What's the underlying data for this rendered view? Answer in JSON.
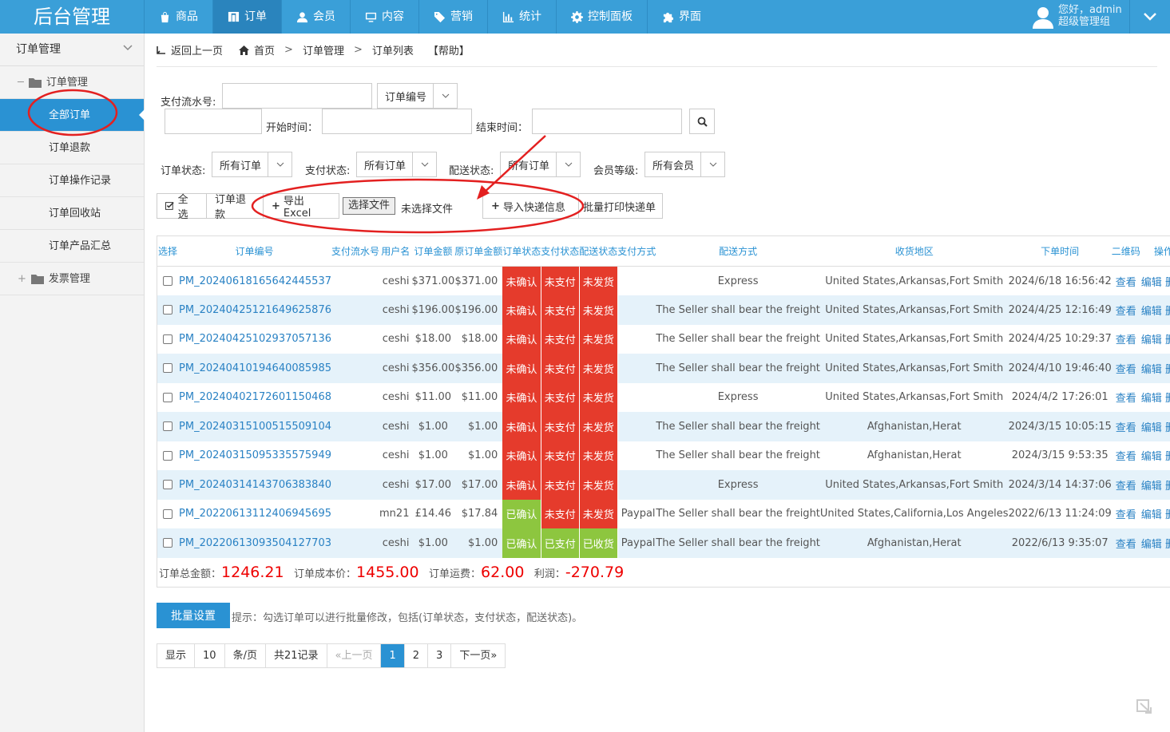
{
  "app": {
    "title": "后台管理"
  },
  "topnav": [
    {
      "label": "商品",
      "icon": "bag-icon"
    },
    {
      "label": "订单",
      "icon": "grid-icon",
      "active": true
    },
    {
      "label": "会员",
      "icon": "user-icon"
    },
    {
      "label": "内容",
      "icon": "monitor-icon"
    },
    {
      "label": "营销",
      "icon": "tag-icon"
    },
    {
      "label": "统计",
      "icon": "bar-chart-icon"
    },
    {
      "label": "控制面板",
      "icon": "gear-icon"
    },
    {
      "label": "界面",
      "icon": "puzzle-icon"
    }
  ],
  "user": {
    "greeting": "您好，admin",
    "role": "超级管理组"
  },
  "sidebar": {
    "header": "订单管理",
    "folder1": "订单管理",
    "items": [
      "全部订单",
      "订单退款",
      "订单操作记录",
      "订单回收站",
      "订单产品汇总"
    ],
    "folder2": "发票管理"
  },
  "breadcrumb": {
    "back": "返回上一页",
    "home": "首页",
    "c1": "订单管理",
    "c2": "订单列表",
    "help": "【帮助】"
  },
  "filters": {
    "pay_serial_label": "支付流水号:",
    "order_no_select": "订单编号",
    "start_label": "开始时间：",
    "end_label": "结束时间：",
    "order_status_label": "订单状态:",
    "order_status_value": "所有订单",
    "pay_status_label": "支付状态:",
    "pay_status_value": "所有订单",
    "ship_status_label": "配送状态:",
    "ship_status_value": "所有订单",
    "member_level_label": "会员等级:",
    "member_level_value": "所有会员"
  },
  "toolbar": {
    "select_all": "全选",
    "refund": "订单退款",
    "export": "导出Excel",
    "choose_file": "选择文件",
    "no_file": "未选择文件",
    "import": "导入快递信息",
    "print": "批量打印快递单"
  },
  "table": {
    "headers": [
      "选择",
      "订单编号",
      "支付流水号",
      "用户名",
      "订单金额",
      "原订单金额",
      "订单状态",
      "支付状态",
      "配送状态",
      "支付方式",
      "配送方式",
      "收货地区",
      "下单时间",
      "二维码",
      "操作"
    ],
    "rows": [
      {
        "id": "PM_20240618165642445537",
        "user": "ceshi",
        "amount": "$371.00",
        "orig": "$371.00",
        "os": "未确认",
        "ps": "未支付",
        "ss": "未发货",
        "pay": "",
        "ship": "Express",
        "region": "United States,Arkansas,Fort Smith",
        "time": "2024/6/18 16:56:42"
      },
      {
        "id": "PM_20240425121649625876",
        "user": "ceshi",
        "amount": "$196.00",
        "orig": "$196.00",
        "os": "未确认",
        "ps": "未支付",
        "ss": "未发货",
        "pay": "",
        "ship": "The Seller shall bear the freight",
        "region": "United States,Arkansas,Fort Smith",
        "time": "2024/4/25 12:16:49"
      },
      {
        "id": "PM_20240425102937057136",
        "user": "ceshi",
        "amount": "$18.00",
        "orig": "$18.00",
        "os": "未确认",
        "ps": "未支付",
        "ss": "未发货",
        "pay": "",
        "ship": "The Seller shall bear the freight",
        "region": "United States,Arkansas,Fort Smith",
        "time": "2024/4/25 10:29:37"
      },
      {
        "id": "PM_20240410194640085985",
        "user": "ceshi",
        "amount": "$356.00",
        "orig": "$356.00",
        "os": "未确认",
        "ps": "未支付",
        "ss": "未发货",
        "pay": "",
        "ship": "The Seller shall bear the freight",
        "region": "United States,Arkansas,Fort Smith",
        "time": "2024/4/10 19:46:40"
      },
      {
        "id": "PM_20240402172601150468",
        "user": "ceshi",
        "amount": "$11.00",
        "orig": "$11.00",
        "os": "未确认",
        "ps": "未支付",
        "ss": "未发货",
        "pay": "",
        "ship": "Express",
        "region": "United States,Arkansas,Fort Smith",
        "time": "2024/4/2 17:26:01"
      },
      {
        "id": "PM_20240315100515509104",
        "user": "ceshi",
        "amount": "$1.00",
        "orig": "$1.00",
        "os": "未确认",
        "ps": "未支付",
        "ss": "未发货",
        "pay": "",
        "ship": "The Seller shall bear the freight",
        "region": "Afghanistan,Herat",
        "time": "2024/3/15 10:05:15"
      },
      {
        "id": "PM_20240315095335575949",
        "user": "ceshi",
        "amount": "$1.00",
        "orig": "$1.00",
        "os": "未确认",
        "ps": "未支付",
        "ss": "未发货",
        "pay": "",
        "ship": "The Seller shall bear the freight",
        "region": "Afghanistan,Herat",
        "time": "2024/3/15 9:53:35"
      },
      {
        "id": "PM_20240314143706383840",
        "user": "ceshi",
        "amount": "$17.00",
        "orig": "$17.00",
        "os": "未确认",
        "ps": "未支付",
        "ss": "未发货",
        "pay": "",
        "ship": "Express",
        "region": "United States,Arkansas,Fort Smith",
        "time": "2024/3/14 14:37:06"
      },
      {
        "id": "PM_20220613112406945695",
        "user": "mn21",
        "amount": "£14.46",
        "orig": "$17.84",
        "os": "已确认",
        "ps": "未支付",
        "ss": "未发货",
        "pay": "Paypal",
        "ship": "The Seller shall bear the freight",
        "region": "United States,California,Los Angeles",
        "time": "2022/6/13 11:24:09"
      },
      {
        "id": "PM_20220613093504127703",
        "user": "ceshi",
        "amount": "$1.00",
        "orig": "$1.00",
        "os": "已确认",
        "ps": "已支付",
        "ss": "已收货",
        "pay": "Paypal",
        "ship": "The Seller shall bear the freight",
        "region": "Afghanistan,Herat",
        "time": "2022/6/13 9:35:07"
      }
    ],
    "actions": [
      "查看",
      "编辑",
      "删除"
    ]
  },
  "summary": {
    "total_label": "订单总金额：",
    "total": "1246.21",
    "cost_label": "订单成本价：",
    "cost": "1455.00",
    "freight_label": "订单运费：",
    "freight": "62.00",
    "profit_label": "利润：",
    "profit": "-270.79"
  },
  "batch": {
    "button": "批量设置",
    "hint": "提示：勾选订单可以进行批量修改，包括(订单状态，支付状态，配送状态)。"
  },
  "pager": {
    "show": "显示",
    "per": "10",
    "unit": "条/页",
    "total": "共21记录",
    "prev": "«上一页",
    "pages": [
      "1",
      "2",
      "3"
    ],
    "next": "下一页»"
  },
  "colors": {
    "topbar": "#3a9fd8",
    "accent": "#2a92d3",
    "status_red": "#e53b2c",
    "status_green": "#8dc63f",
    "annotation": "#e32020"
  }
}
